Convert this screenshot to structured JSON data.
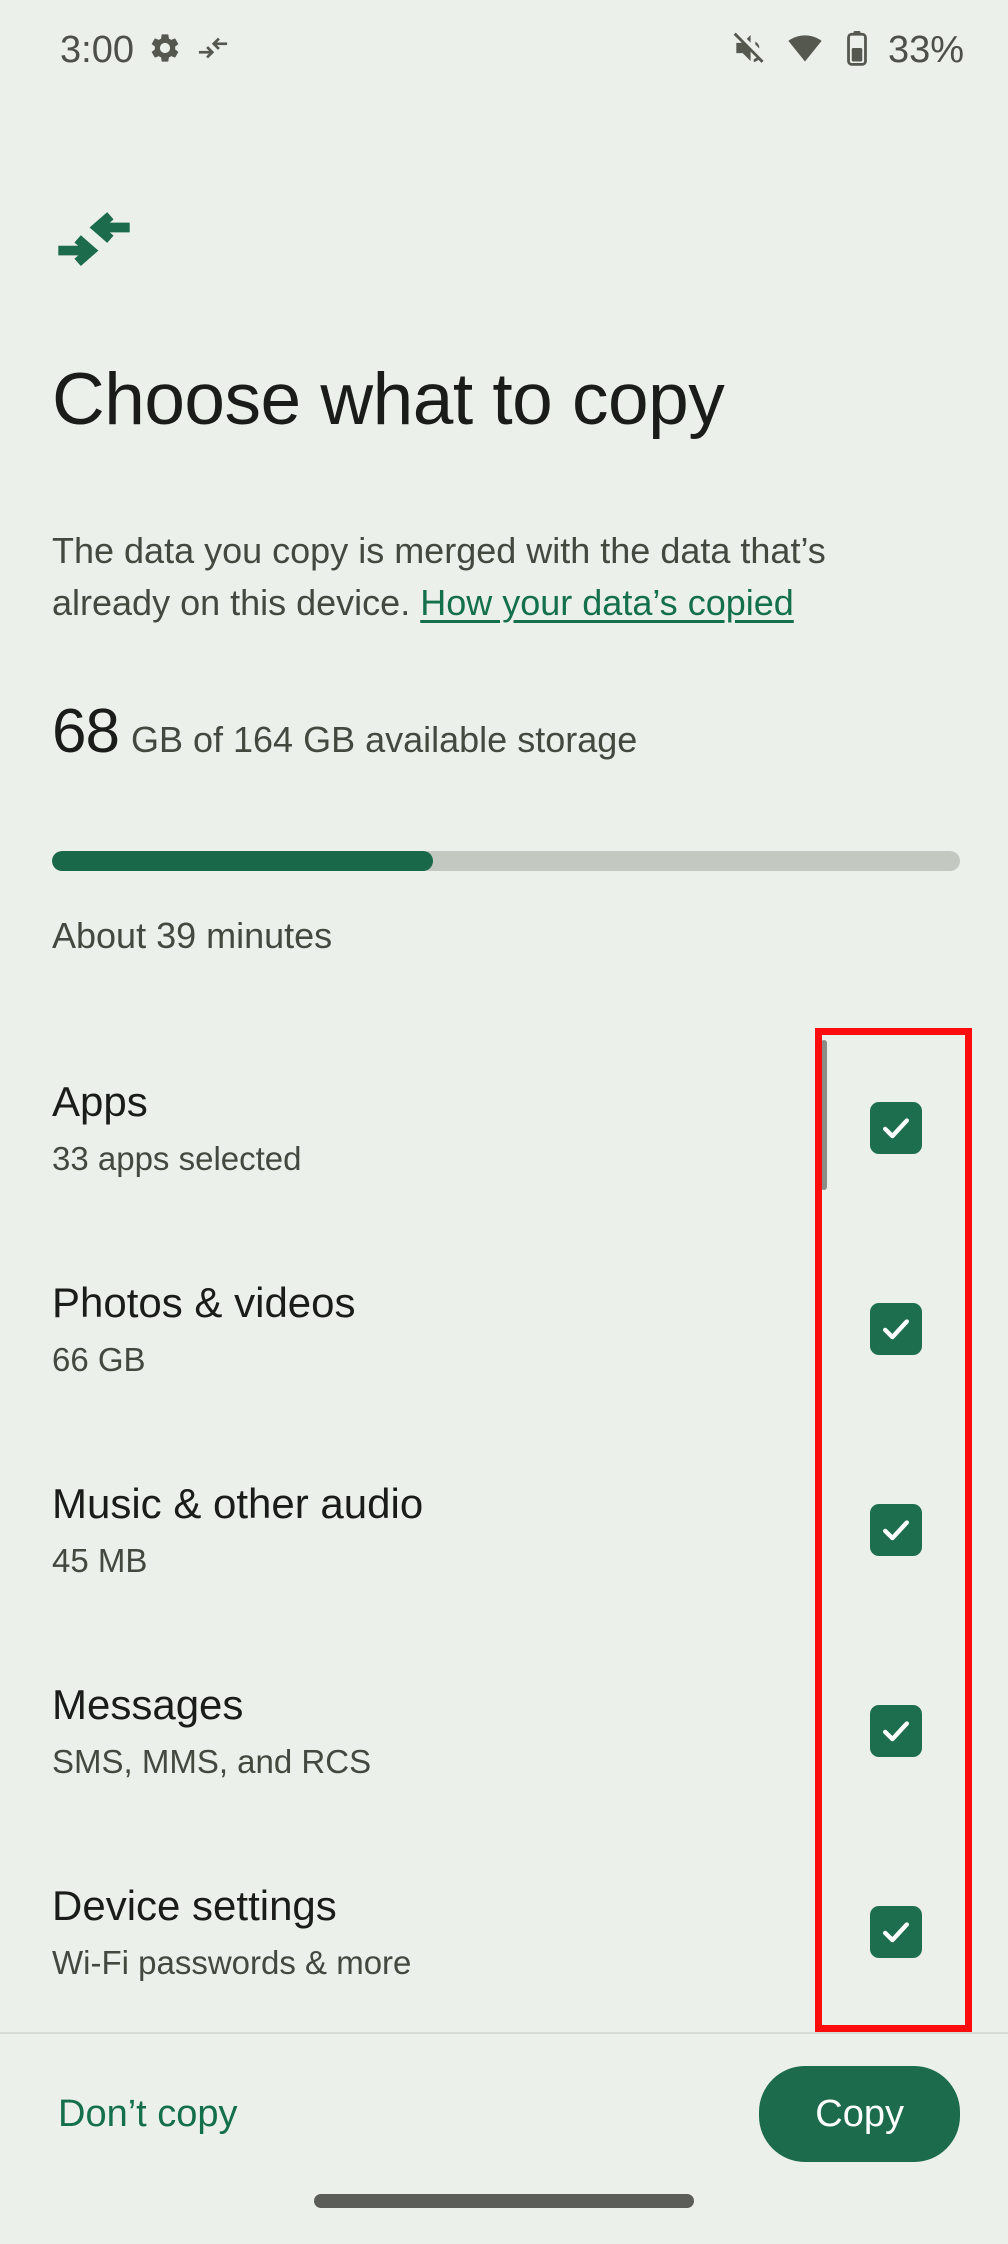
{
  "status_bar": {
    "time": "3:00",
    "gear_icon": "gear-icon",
    "transfer_icon": "transfer-arrows-icon",
    "mute_icon": "volume-mute-icon",
    "wifi_icon": "wifi-icon",
    "battery_icon": "battery-icon",
    "battery_percent": "33%"
  },
  "header": {
    "icon": "transfer-arrows-icon",
    "title": "Choose what to copy"
  },
  "description": {
    "text": "The data you copy is merged with the data that’s already on this device. ",
    "link_label": "How your data’s copied"
  },
  "storage": {
    "value": "68",
    "caption": "GB of 164 GB available storage",
    "progress_percent": 42,
    "time_estimate": "About 39 minutes"
  },
  "categories": [
    {
      "title": "Apps",
      "subtitle": "33 apps selected",
      "checked": true,
      "check_icon": "checkmark-icon"
    },
    {
      "title": "Photos & videos",
      "subtitle": "66 GB",
      "checked": true,
      "check_icon": "checkmark-icon"
    },
    {
      "title": "Music & other audio",
      "subtitle": "45 MB",
      "checked": true,
      "check_icon": "checkmark-icon"
    },
    {
      "title": "Messages",
      "subtitle": "SMS, MMS, and RCS",
      "checked": true,
      "check_icon": "checkmark-icon"
    },
    {
      "title": "Device settings",
      "subtitle": "Wi-Fi passwords & more",
      "checked": true,
      "check_icon": "checkmark-icon"
    }
  ],
  "bottom_bar": {
    "secondary_label": "Don’t copy",
    "primary_label": "Copy"
  },
  "annotation": {
    "shape": "rectangle",
    "color": "#fb0d0d"
  },
  "colors": {
    "background": "#ebf0ea",
    "accent_green": "#1b6b4c",
    "link_green": "#14704a",
    "text_primary": "#1a1c19",
    "text_secondary": "#43493f",
    "progress_track": "#c3c9c0",
    "annotation_red": "#fb0d0d"
  }
}
